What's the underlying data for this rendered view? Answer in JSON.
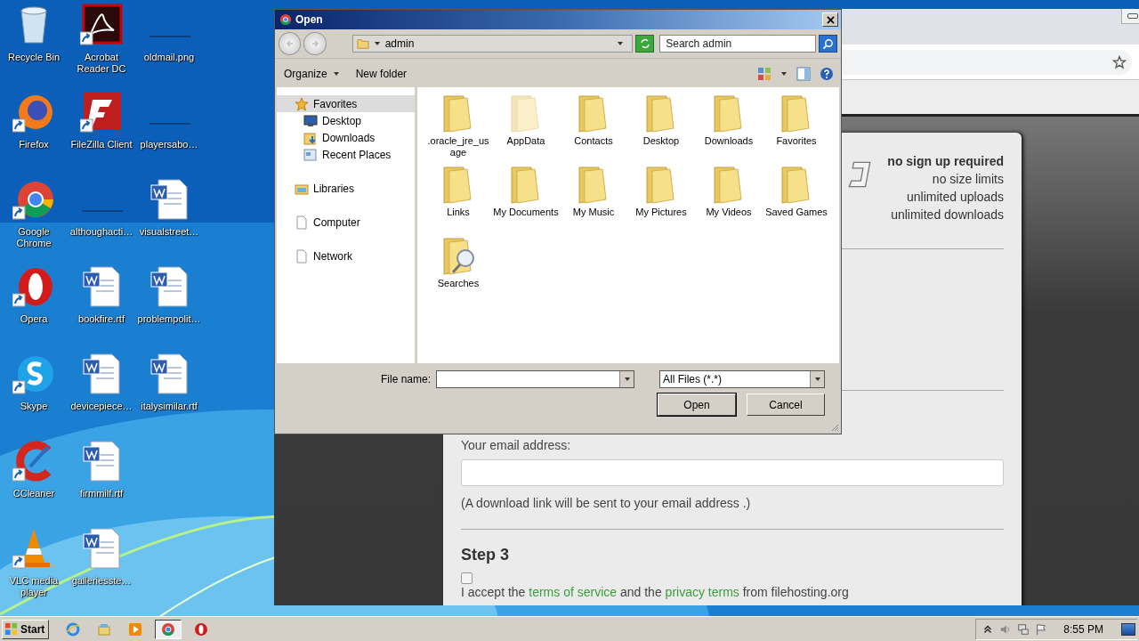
{
  "desktop_icons": [
    {
      "label": "Recycle Bin",
      "kind": "recycle-bin"
    },
    {
      "label": "Firefox",
      "kind": "firefox"
    },
    {
      "label": "Google Chrome",
      "kind": "chrome"
    },
    {
      "label": "Opera",
      "kind": "opera"
    },
    {
      "label": "Skype",
      "kind": "skype"
    },
    {
      "label": "CCleaner",
      "kind": "ccleaner"
    },
    {
      "label": "VLC media player",
      "kind": "vlc"
    },
    {
      "label": "Acrobat Reader DC",
      "kind": "acrobat"
    },
    {
      "label": "FileZilla Client",
      "kind": "filezilla"
    },
    {
      "label": "althoughacti…",
      "kind": "blank"
    },
    {
      "label": "bookfire.rtf",
      "kind": "word"
    },
    {
      "label": "devicepiece…",
      "kind": "word"
    },
    {
      "label": "firmmilf.rtf",
      "kind": "word"
    },
    {
      "label": "galleriesste…",
      "kind": "word"
    },
    {
      "label": "oldmail.png",
      "kind": "blank"
    },
    {
      "label": "playersabo…",
      "kind": "blank"
    },
    {
      "label": "visualstreet…",
      "kind": "word"
    },
    {
      "label": "problempolit…",
      "kind": "word"
    },
    {
      "label": "italysimilar.rtf",
      "kind": "word"
    }
  ],
  "browser": {
    "features": [
      {
        "text": "no sign up required",
        "bold": true
      },
      {
        "text": "no size limits",
        "bold": false
      },
      {
        "text": "unlimited uploads",
        "bold": false
      },
      {
        "text": "unlimited downloads",
        "bold": false
      }
    ],
    "email_label": "Your email address:",
    "email_note": "(A download link will be sent to your email address .)",
    "step_title": "Step 3",
    "terms_checked": false,
    "terms": [
      {
        "text": "I accept the ",
        "kind": "text"
      },
      {
        "text": "terms of service",
        "kind": "link"
      },
      {
        "text": " and the ",
        "kind": "text"
      },
      {
        "text": "privacy terms",
        "kind": "link"
      },
      {
        "text": " from filehosting.org",
        "kind": "text"
      }
    ]
  },
  "dialog": {
    "title": "Open",
    "location": "admin",
    "search_placeholder": "Search admin",
    "toolbar": [
      {
        "label": "Organize",
        "kind": "menu"
      },
      {
        "label": "New folder",
        "kind": "button"
      }
    ],
    "nav": [
      {
        "label": "Favorites",
        "kind": "star",
        "selected": true,
        "children": [
          {
            "label": "Desktop",
            "kind": "desktop",
            "selected": false
          },
          {
            "label": "Downloads",
            "kind": "downloads",
            "selected": false
          },
          {
            "label": "Recent Places",
            "kind": "recent",
            "selected": false
          }
        ]
      },
      {
        "label": "Libraries",
        "kind": "library",
        "selected": false
      },
      {
        "label": "Computer",
        "kind": "page",
        "selected": false
      },
      {
        "label": "Network",
        "kind": "page",
        "selected": false
      }
    ],
    "files": [
      {
        "label": ".oracle_jre_usage",
        "kind": "folder",
        "hidden": false
      },
      {
        "label": "AppData",
        "kind": "folder",
        "hidden": true
      },
      {
        "label": "Contacts",
        "kind": "folder",
        "hidden": false
      },
      {
        "label": "Desktop",
        "kind": "folder",
        "hidden": false
      },
      {
        "label": "Downloads",
        "kind": "folder",
        "hidden": false
      },
      {
        "label": "Favorites",
        "kind": "folder",
        "hidden": false
      },
      {
        "label": "Links",
        "kind": "folder",
        "hidden": false
      },
      {
        "label": "My Documents",
        "kind": "folder",
        "hidden": false
      },
      {
        "label": "My Music",
        "kind": "folder",
        "hidden": false
      },
      {
        "label": "My Pictures",
        "kind": "folder",
        "hidden": false
      },
      {
        "label": "My Videos",
        "kind": "folder",
        "hidden": false
      },
      {
        "label": "Saved Games",
        "kind": "folder",
        "hidden": false
      },
      {
        "label": "Searches",
        "kind": "search-folder",
        "hidden": false
      }
    ],
    "file_name_label": "File name:",
    "file_type": "All Files (*.*)",
    "buttons": [
      {
        "label": "Open",
        "default": true
      },
      {
        "label": "Cancel",
        "default": false
      }
    ]
  },
  "taskbar": {
    "start": "Start",
    "apps": [
      {
        "kind": "ie",
        "active": false
      },
      {
        "kind": "explorer",
        "active": false
      },
      {
        "kind": "media",
        "active": false
      },
      {
        "kind": "chrome",
        "active": true
      },
      {
        "kind": "opera",
        "active": false
      }
    ],
    "clock": "8:55 PM"
  }
}
